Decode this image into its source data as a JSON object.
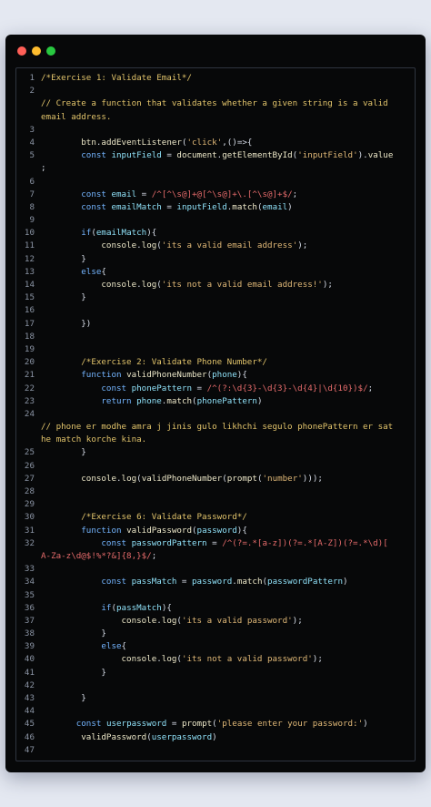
{
  "window": {
    "controls": [
      "close",
      "minimize",
      "maximize"
    ],
    "colors": {
      "close": "#ff5f57",
      "minimize": "#febc2e",
      "maximize": "#28c840",
      "background": "#070809"
    }
  },
  "code_lines": [
    {
      "n": "1",
      "tokens": [
        [
          "c",
          "/*Exercise 1: Validate Email*/"
        ]
      ]
    },
    {
      "n": "2",
      "tokens": []
    },
    {
      "n": "",
      "tokens": [
        [
          "c",
          "// Create a function that validates whether a given string is a valid"
        ]
      ]
    },
    {
      "n": "",
      "tokens": [
        [
          "c",
          "email address."
        ]
      ]
    },
    {
      "n": "3",
      "tokens": []
    },
    {
      "n": "4",
      "tokens": [
        [
          "p",
          "        "
        ],
        [
          "f",
          "btn"
        ],
        [
          "p",
          "."
        ],
        [
          "f",
          "addEventListener"
        ],
        [
          "p",
          "("
        ],
        [
          "s",
          "'click'"
        ],
        [
          "p",
          ",()=>{"
        ]
      ]
    },
    {
      "n": "5",
      "tokens": [
        [
          "p",
          "        "
        ],
        [
          "k",
          "const "
        ],
        [
          "v",
          "inputField"
        ],
        [
          "p",
          " = "
        ],
        [
          "f",
          "document"
        ],
        [
          "p",
          "."
        ],
        [
          "f",
          "getElementById"
        ],
        [
          "p",
          "("
        ],
        [
          "s",
          "'inputField'"
        ],
        [
          "p",
          ")."
        ],
        [
          "f",
          "value"
        ]
      ]
    },
    {
      "n": "",
      "tokens": [
        [
          "p",
          ";"
        ]
      ]
    },
    {
      "n": "6",
      "tokens": []
    },
    {
      "n": "7",
      "tokens": [
        [
          "p",
          "        "
        ],
        [
          "k",
          "const "
        ],
        [
          "v",
          "email"
        ],
        [
          "p",
          " = "
        ],
        [
          "r",
          "/^[^\\s@]+@[^\\s@]+\\.[^\\s@]+$/"
        ],
        [
          "p",
          ";"
        ]
      ]
    },
    {
      "n": "8",
      "tokens": [
        [
          "p",
          "        "
        ],
        [
          "k",
          "const "
        ],
        [
          "v",
          "emailMatch"
        ],
        [
          "p",
          " = "
        ],
        [
          "v",
          "inputField"
        ],
        [
          "p",
          "."
        ],
        [
          "f",
          "match"
        ],
        [
          "p",
          "("
        ],
        [
          "v",
          "email"
        ],
        [
          "p",
          ")"
        ]
      ]
    },
    {
      "n": "9",
      "tokens": []
    },
    {
      "n": "10",
      "tokens": [
        [
          "p",
          "        "
        ],
        [
          "k",
          "if"
        ],
        [
          "p",
          "("
        ],
        [
          "v",
          "emailMatch"
        ],
        [
          "p",
          "){"
        ]
      ]
    },
    {
      "n": "11",
      "tokens": [
        [
          "p",
          "            "
        ],
        [
          "f",
          "console"
        ],
        [
          "p",
          "."
        ],
        [
          "f",
          "log"
        ],
        [
          "p",
          "("
        ],
        [
          "s",
          "'its a valid email address'"
        ],
        [
          "p",
          ");"
        ]
      ]
    },
    {
      "n": "12",
      "tokens": [
        [
          "p",
          "        }"
        ]
      ]
    },
    {
      "n": "13",
      "tokens": [
        [
          "p",
          "        "
        ],
        [
          "k",
          "else"
        ],
        [
          "p",
          "{"
        ]
      ]
    },
    {
      "n": "14",
      "tokens": [
        [
          "p",
          "            "
        ],
        [
          "f",
          "console"
        ],
        [
          "p",
          "."
        ],
        [
          "f",
          "log"
        ],
        [
          "p",
          "("
        ],
        [
          "s",
          "'its not a valid email address!'"
        ],
        [
          "p",
          ");"
        ]
      ]
    },
    {
      "n": "15",
      "tokens": [
        [
          "p",
          "        }"
        ]
      ]
    },
    {
      "n": "16",
      "tokens": []
    },
    {
      "n": "17",
      "tokens": [
        [
          "p",
          "        })"
        ]
      ]
    },
    {
      "n": "18",
      "tokens": []
    },
    {
      "n": "19",
      "tokens": []
    },
    {
      "n": "20",
      "tokens": [
        [
          "p",
          "        "
        ],
        [
          "c",
          "/*Exercise 2: Validate Phone Number*/"
        ]
      ]
    },
    {
      "n": "21",
      "tokens": [
        [
          "p",
          "        "
        ],
        [
          "k",
          "function "
        ],
        [
          "f",
          "validPhoneNumber"
        ],
        [
          "p",
          "("
        ],
        [
          "v",
          "phone"
        ],
        [
          "p",
          "){"
        ]
      ]
    },
    {
      "n": "22",
      "tokens": [
        [
          "p",
          "            "
        ],
        [
          "k",
          "const "
        ],
        [
          "v",
          "phonePattern"
        ],
        [
          "p",
          " = "
        ],
        [
          "r",
          "/^(?:\\d{3}-\\d{3}-\\d{4}|\\d{10})$/"
        ],
        [
          "p",
          ";"
        ]
      ]
    },
    {
      "n": "23",
      "tokens": [
        [
          "p",
          "            "
        ],
        [
          "k",
          "return "
        ],
        [
          "v",
          "phone"
        ],
        [
          "p",
          "."
        ],
        [
          "f",
          "match"
        ],
        [
          "p",
          "("
        ],
        [
          "v",
          "phonePattern"
        ],
        [
          "p",
          ")"
        ]
      ]
    },
    {
      "n": "24",
      "tokens": []
    },
    {
      "n": "",
      "tokens": [
        [
          "c",
          "// phone er modhe amra j jinis gulo likhchi segulo phonePattern er sat"
        ]
      ]
    },
    {
      "n": "",
      "tokens": [
        [
          "c",
          "he match korche kina."
        ]
      ]
    },
    {
      "n": "25",
      "tokens": [
        [
          "p",
          "        }"
        ]
      ]
    },
    {
      "n": "26",
      "tokens": []
    },
    {
      "n": "27",
      "tokens": [
        [
          "p",
          "        "
        ],
        [
          "f",
          "console"
        ],
        [
          "p",
          "."
        ],
        [
          "f",
          "log"
        ],
        [
          "p",
          "("
        ],
        [
          "f",
          "validPhoneNumber"
        ],
        [
          "p",
          "("
        ],
        [
          "f",
          "prompt"
        ],
        [
          "p",
          "("
        ],
        [
          "s",
          "'number'"
        ],
        [
          "p",
          ")));"
        ]
      ]
    },
    {
      "n": "28",
      "tokens": []
    },
    {
      "n": "29",
      "tokens": []
    },
    {
      "n": "30",
      "tokens": [
        [
          "p",
          "        "
        ],
        [
          "c",
          "/*Exercise 6: Validate Password*/"
        ]
      ]
    },
    {
      "n": "31",
      "tokens": [
        [
          "p",
          "        "
        ],
        [
          "k",
          "function "
        ],
        [
          "f",
          "validPassword"
        ],
        [
          "p",
          "("
        ],
        [
          "v",
          "password"
        ],
        [
          "p",
          "){"
        ]
      ]
    },
    {
      "n": "32",
      "tokens": [
        [
          "p",
          "            "
        ],
        [
          "k",
          "const "
        ],
        [
          "v",
          "passwordPattern"
        ],
        [
          "p",
          " = "
        ],
        [
          "r",
          "/^(?=.*[a-z])(?=.*[A-Z])(?=.*\\d)["
        ]
      ]
    },
    {
      "n": "",
      "tokens": [
        [
          "r",
          "A-Za-z\\d@$!%*?&]{8,}$/"
        ],
        [
          "p",
          ";"
        ]
      ]
    },
    {
      "n": "33",
      "tokens": []
    },
    {
      "n": "34",
      "tokens": [
        [
          "p",
          "            "
        ],
        [
          "k",
          "const "
        ],
        [
          "v",
          "passMatch"
        ],
        [
          "p",
          " = "
        ],
        [
          "v",
          "password"
        ],
        [
          "p",
          "."
        ],
        [
          "f",
          "match"
        ],
        [
          "p",
          "("
        ],
        [
          "v",
          "passwordPattern"
        ],
        [
          "p",
          ")"
        ]
      ]
    },
    {
      "n": "35",
      "tokens": []
    },
    {
      "n": "36",
      "tokens": [
        [
          "p",
          "            "
        ],
        [
          "k",
          "if"
        ],
        [
          "p",
          "("
        ],
        [
          "v",
          "passMatch"
        ],
        [
          "p",
          "){"
        ]
      ]
    },
    {
      "n": "37",
      "tokens": [
        [
          "p",
          "                "
        ],
        [
          "f",
          "console"
        ],
        [
          "p",
          "."
        ],
        [
          "f",
          "log"
        ],
        [
          "p",
          "("
        ],
        [
          "s",
          "'its a valid password'"
        ],
        [
          "p",
          ");"
        ]
      ]
    },
    {
      "n": "38",
      "tokens": [
        [
          "p",
          "            }"
        ]
      ]
    },
    {
      "n": "39",
      "tokens": [
        [
          "p",
          "            "
        ],
        [
          "k",
          "else"
        ],
        [
          "p",
          "{"
        ]
      ]
    },
    {
      "n": "40",
      "tokens": [
        [
          "p",
          "                "
        ],
        [
          "f",
          "console"
        ],
        [
          "p",
          "."
        ],
        [
          "f",
          "log"
        ],
        [
          "p",
          "("
        ],
        [
          "s",
          "'its not a valid password'"
        ],
        [
          "p",
          ");"
        ]
      ]
    },
    {
      "n": "41",
      "tokens": [
        [
          "p",
          "            }"
        ]
      ]
    },
    {
      "n": "42",
      "tokens": []
    },
    {
      "n": "43",
      "tokens": [
        [
          "p",
          "        }"
        ]
      ]
    },
    {
      "n": "44",
      "tokens": []
    },
    {
      "n": "45",
      "tokens": [
        [
          "p",
          "       "
        ],
        [
          "k",
          "const "
        ],
        [
          "v",
          "userpassword"
        ],
        [
          "p",
          " = "
        ],
        [
          "f",
          "prompt"
        ],
        [
          "p",
          "("
        ],
        [
          "s",
          "'please enter your password:'"
        ],
        [
          "p",
          ")"
        ]
      ]
    },
    {
      "n": "46",
      "tokens": [
        [
          "p",
          "        "
        ],
        [
          "f",
          "validPassword"
        ],
        [
          "p",
          "("
        ],
        [
          "v",
          "userpassword"
        ],
        [
          "p",
          ")"
        ]
      ]
    },
    {
      "n": "47",
      "tokens": []
    }
  ]
}
